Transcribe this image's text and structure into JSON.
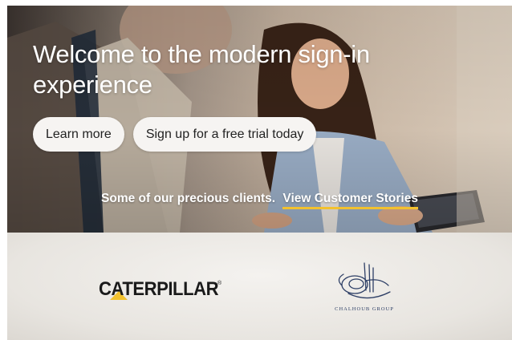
{
  "hero": {
    "title": "Welcome to the modern sign-in experience",
    "buttons": {
      "learn_more": "Learn more",
      "free_trial": "Sign up for a free trial today"
    },
    "clients_text": "Some of our precious clients.",
    "stories_link": "View Customer Stories"
  },
  "logos": {
    "caterpillar": "CATERPILLAR",
    "caterpillar_tm": "®",
    "chalhoub": "CHALHOUB GROUP"
  },
  "colors": {
    "link_underline": "#f2c12e",
    "caterpillar_yellow": "#f2c12e",
    "chalhoub_navy": "#2e3f66"
  }
}
